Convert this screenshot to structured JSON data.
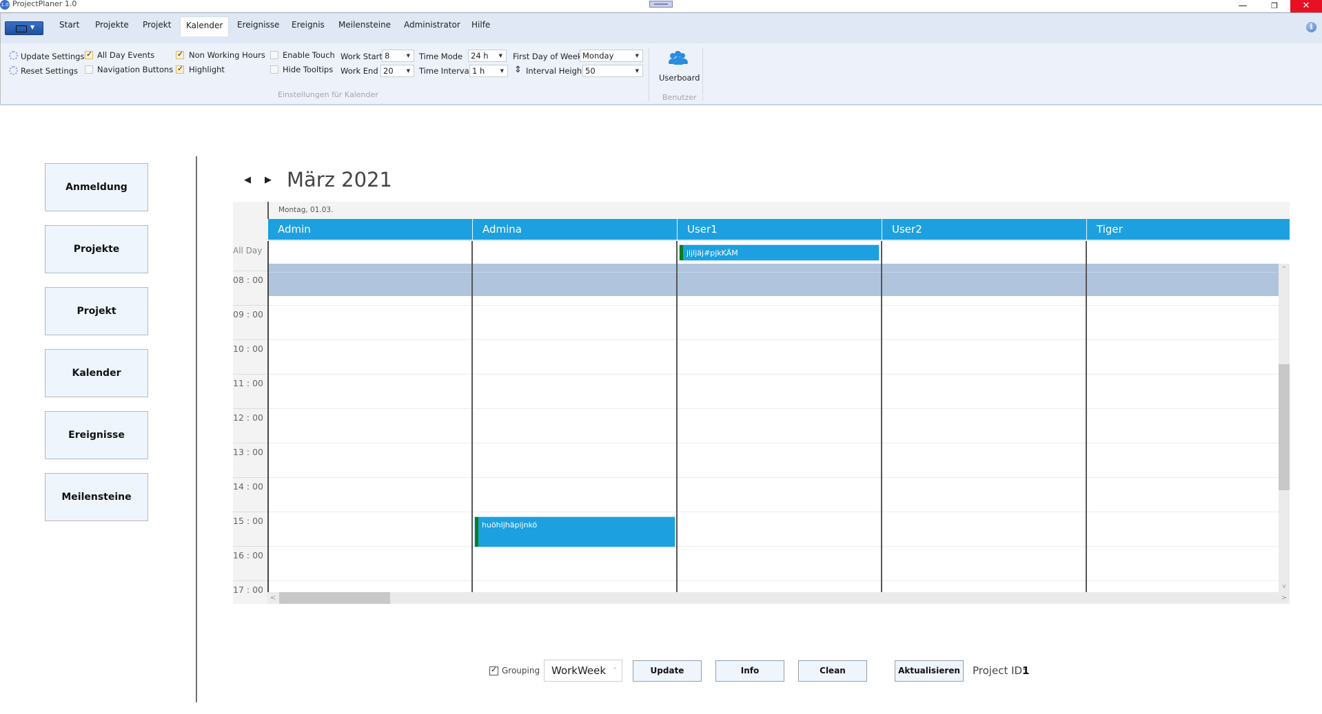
{
  "window": {
    "title": "ProjectPlaner 1.0",
    "app_icon": "1.0",
    "minimize_icon": "—",
    "restore_icon": "❐",
    "close_icon": "✕"
  },
  "menu": {
    "tabs": [
      {
        "label": "Start"
      },
      {
        "label": "Projekte"
      },
      {
        "label": "Projekt"
      },
      {
        "label": "Kalender",
        "active": true
      },
      {
        "label": "Ereignisse"
      },
      {
        "label": "Ereignis"
      },
      {
        "label": "Meilensteine"
      },
      {
        "label": "Administrator"
      },
      {
        "label": "Hilfe"
      }
    ],
    "info_icon": "i"
  },
  "ribbon": {
    "update_settings": "Update Settings",
    "reset_settings": "Reset Settings",
    "checkboxes": {
      "all_day_events": {
        "label": "All Day Events",
        "checked": true
      },
      "navigation_buttons": {
        "label": "Navigation Buttons",
        "checked": false
      },
      "non_working_hours": {
        "label": "Non Working Hours",
        "checked": true
      },
      "highlight": {
        "label": "Highlight",
        "checked": true
      },
      "enable_touch": {
        "label": "Enable Touch",
        "checked": false
      },
      "hide_tooltips": {
        "label": "Hide Tooltips",
        "checked": false
      }
    },
    "work_start": {
      "label": "Work Start",
      "value": "8"
    },
    "work_end": {
      "label": "Work End",
      "value": "20"
    },
    "time_mode": {
      "label": "Time Mode",
      "value": "24 h"
    },
    "time_interval": {
      "label": "Time Interval",
      "value": "1 h"
    },
    "first_day_of_week": {
      "label": "First Day of Week",
      "value": "Monday"
    },
    "interval_height": {
      "label": "Interval Height",
      "value": "50"
    },
    "group_calendar_settings": "Einstellungen für Kalender",
    "userboard": "Userboard",
    "group_users": "Benutzer",
    "dropdown_arrow": "▼"
  },
  "nav": {
    "buttons": [
      "Anmeldung",
      "Projekte",
      "Projekt",
      "Kalender",
      "Ereignisse",
      "Meilensteine"
    ]
  },
  "calendar": {
    "prev_icon": "◀",
    "next_icon": "▶",
    "title": "März 2021",
    "day_header": "Montag, 01.03.",
    "resources": [
      "Admin",
      "Admina",
      "User1",
      "User2",
      "Tiger"
    ],
    "all_day_label": "All Day",
    "time_labels": [
      "08 : 00",
      "09 : 00",
      "10 : 00",
      "11 : 00",
      "12 : 00",
      "13 : 00",
      "14 : 00",
      "15 : 00",
      "16 : 00",
      "17 : 00"
    ],
    "appointments": [
      {
        "title": "jijljäj#pjkKÄM",
        "resource": "User1",
        "all_day": true
      },
      {
        "title": "huöhljhäpijnkö",
        "resource": "Admina",
        "start": "15:00",
        "end": "15:55"
      }
    ],
    "scroll_up": "^",
    "scroll_down": "v",
    "scroll_left": "<",
    "scroll_right": ">"
  },
  "bottom": {
    "grouping": {
      "label": "Grouping",
      "checked": true
    },
    "view": {
      "value": "WorkWeek",
      "arrow": "˅"
    },
    "buttons": {
      "update": "Update",
      "info": "Info",
      "clean": "Clean",
      "aktualisieren": "Aktualisieren"
    },
    "project_id_label": "Project ID:",
    "project_id_value": "1"
  }
}
